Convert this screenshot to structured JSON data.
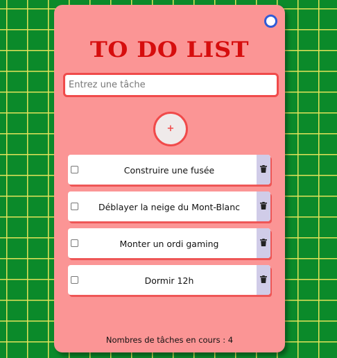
{
  "header": {
    "title": "TO DO LIST"
  },
  "input": {
    "placeholder": "Entrez une tâche",
    "value": ""
  },
  "add_button": {
    "label": "+"
  },
  "tasks": [
    {
      "label": "Construire une fusée",
      "checked": false
    },
    {
      "label": "Déblayer la neige du Mont-Blanc",
      "checked": false
    },
    {
      "label": "Monter un ordi gaming",
      "checked": false
    },
    {
      "label": "Dormir 12h",
      "checked": false
    }
  ],
  "footer": {
    "counter_text": "Nombres de tâches en cours : 4"
  },
  "icons": {
    "theme_toggle": "circle-toggle-icon",
    "delete": "trash-icon"
  },
  "colors": {
    "background": "#0b8a2a",
    "grid_lines": "#e3e35a",
    "card": "#fb9595",
    "title": "#d60d0d",
    "accent": "#f04a4a",
    "delete_bg": "#d0cce8",
    "toggle": "#2f5bd6"
  }
}
